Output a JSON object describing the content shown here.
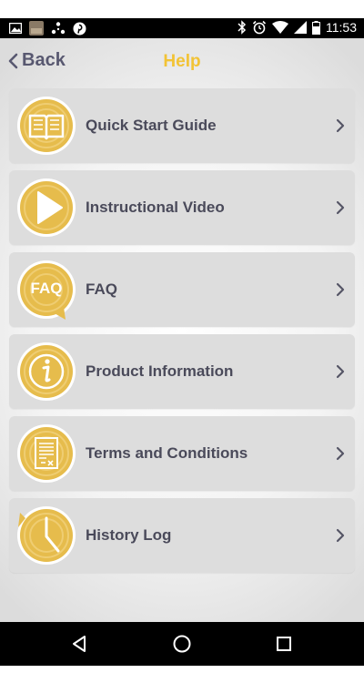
{
  "status_bar": {
    "time": "11:53",
    "left_icons": [
      "image-notification-icon",
      "photo-notification-icon",
      "dots-notification-icon",
      "pinterest-icon"
    ],
    "right_icons": [
      "bluetooth-icon",
      "alarm-icon",
      "wifi-icon",
      "signal-icon",
      "battery-icon"
    ]
  },
  "header": {
    "back_label": "Back",
    "title": "Help"
  },
  "menu": [
    {
      "label": "Quick Start Guide",
      "icon": "book-icon"
    },
    {
      "label": "Instructional Video",
      "icon": "play-icon"
    },
    {
      "label": "FAQ",
      "icon": "faq-icon",
      "icon_text": "FAQ"
    },
    {
      "label": "Product Information",
      "icon": "info-icon"
    },
    {
      "label": "Terms and Conditions",
      "icon": "document-icon"
    },
    {
      "label": "History Log",
      "icon": "history-clock-icon"
    }
  ],
  "colors": {
    "accent": "#f2c335",
    "icon_gold": "#e6bc4c",
    "text": "#4a4a5a",
    "card": "#dddddd"
  },
  "nav_bar": {
    "buttons": [
      "back-triangle-icon",
      "home-circle-icon",
      "recents-square-icon"
    ]
  }
}
